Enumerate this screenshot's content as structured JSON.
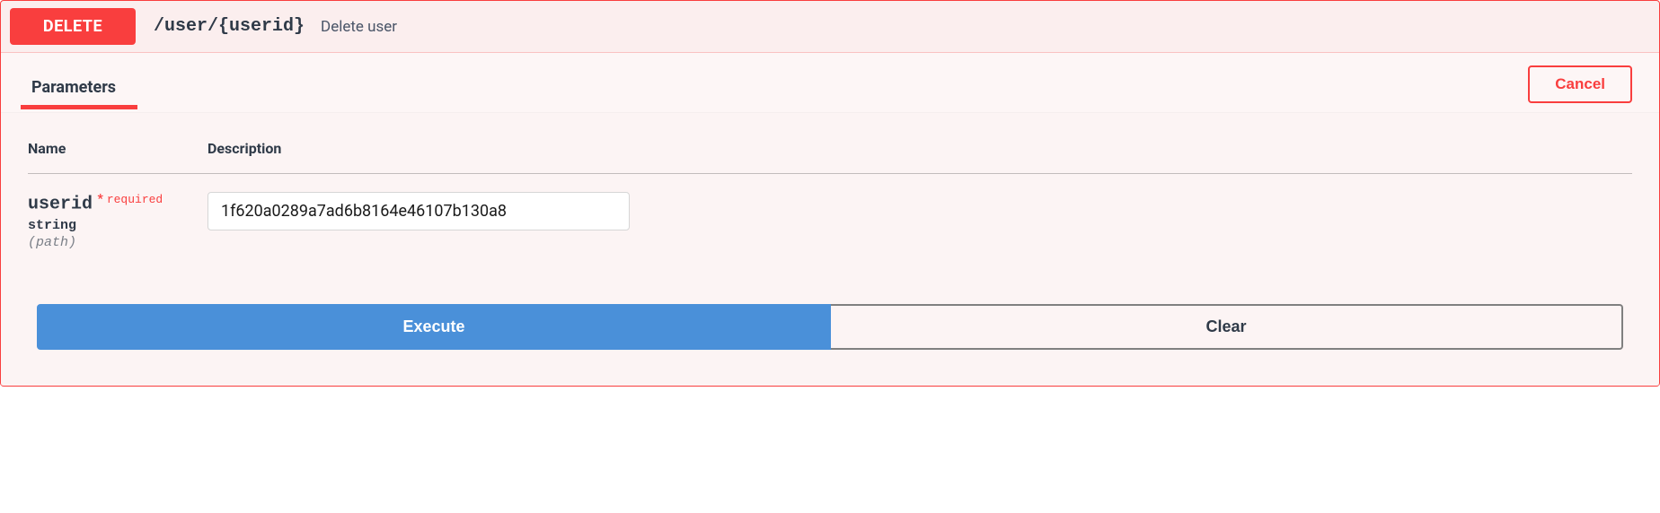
{
  "op": {
    "method": "DELETE",
    "path": "/user/{userid}",
    "summary": "Delete user"
  },
  "section": {
    "tab_label": "Parameters",
    "cancel_label": "Cancel"
  },
  "table": {
    "header_name": "Name",
    "header_description": "Description"
  },
  "param": {
    "name": "userid",
    "required_label": "required",
    "type": "string",
    "in": "(path)",
    "value": "1f620a0289a7ad6b8164e46107b130a8"
  },
  "actions": {
    "execute_label": "Execute",
    "clear_label": "Clear"
  }
}
